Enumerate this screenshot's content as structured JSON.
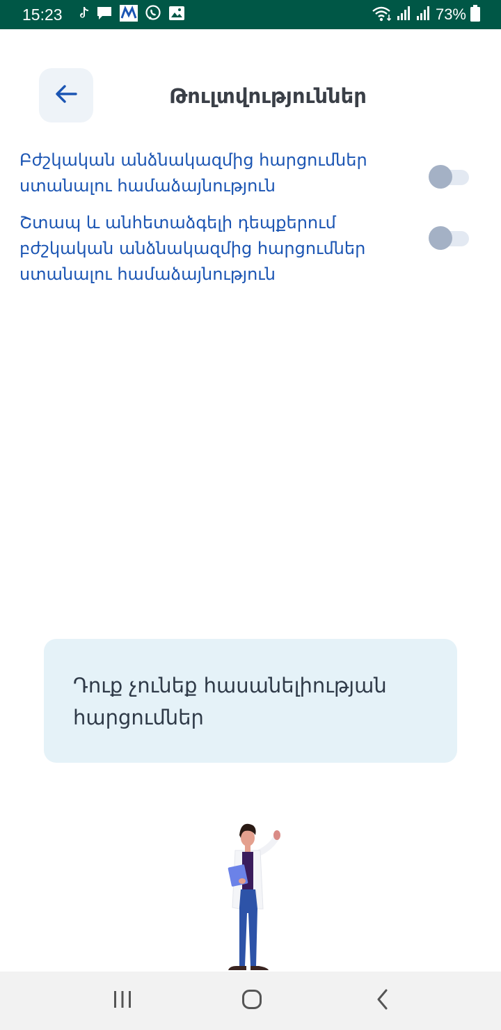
{
  "status_bar": {
    "time": "15:23",
    "battery": "73%",
    "left_icons": [
      "tiktok-icon",
      "message-icon",
      "app-icon",
      "viber-icon",
      "gallery-icon"
    ],
    "right_icons": [
      "wifi-icon",
      "signal-icon",
      "signal-icon",
      "battery-icon"
    ]
  },
  "header": {
    "title": "Թուլտվություններ",
    "back_icon": "arrow-left-icon"
  },
  "consents": [
    {
      "label": "Բժշկական անձնակազմից հարցումներ ստանալու համաձայնություն",
      "enabled": false
    },
    {
      "label": "Շտապ և անհետաձգելի դեպքերում բժշկական անձնակազմից հարցումներ ստանալու համաձայնություն",
      "enabled": false
    }
  ],
  "empty_state": {
    "text": "Դուք չունեք հասանելիության հարցումներ"
  },
  "colors": {
    "status_bar": "#005746",
    "accent_text": "#1b55b3",
    "toggle_thumb": "#a4b1c5",
    "toggle_track": "#e3e9f2",
    "card_background": "#e5f2f8"
  },
  "nav_bar": {
    "icons": [
      "recents-icon",
      "home-icon",
      "back-icon"
    ]
  }
}
